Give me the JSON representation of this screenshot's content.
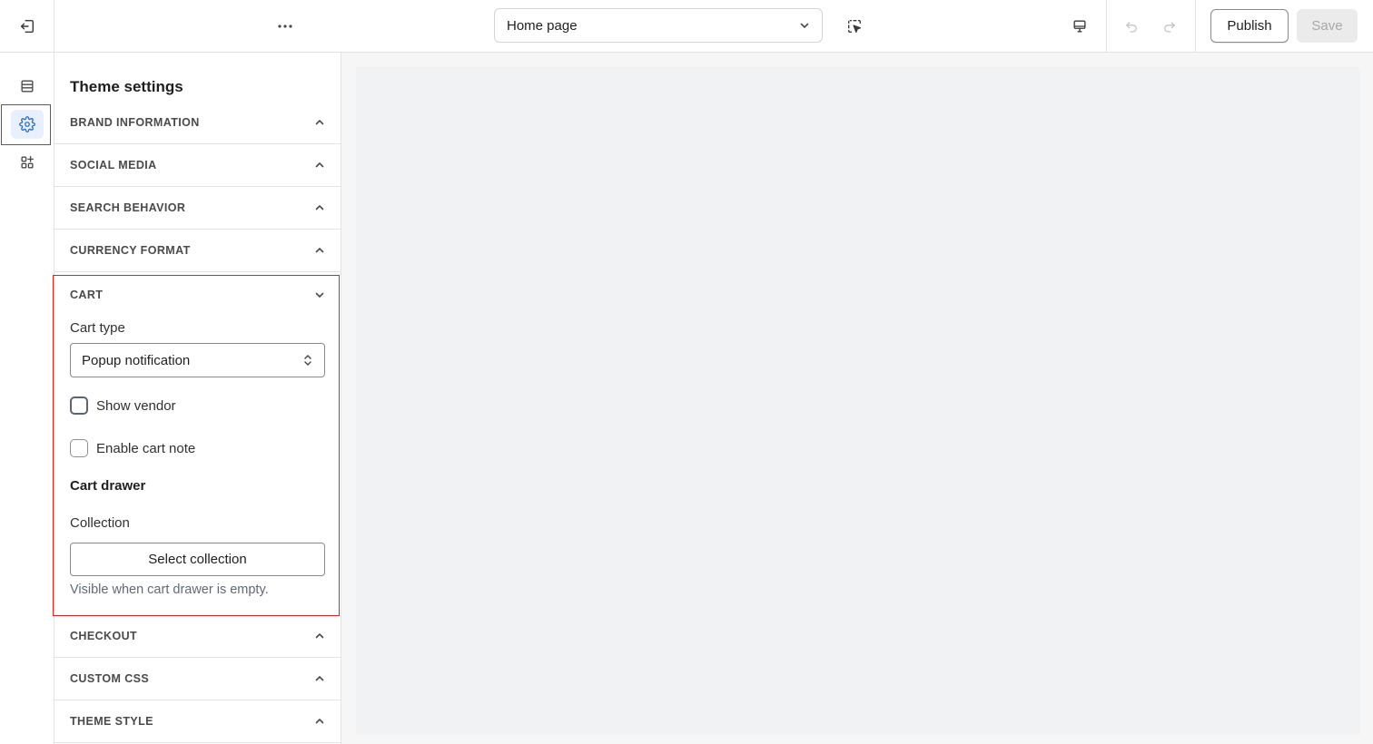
{
  "topbar": {
    "page_selector": {
      "value": "Home page"
    },
    "publish_label": "Publish",
    "save_label": "Save"
  },
  "rail": {
    "items": [
      {
        "icon": "sections-icon",
        "active": false
      },
      {
        "icon": "gear-icon",
        "active": true
      },
      {
        "icon": "apps-add-icon",
        "active": false
      }
    ]
  },
  "panel": {
    "title": "Theme settings",
    "sections_before": [
      {
        "label": "BRAND INFORMATION"
      },
      {
        "label": "SOCIAL MEDIA"
      },
      {
        "label": "SEARCH BEHAVIOR"
      },
      {
        "label": "CURRENCY FORMAT"
      }
    ],
    "cart": {
      "label": "CART",
      "cart_type_label": "Cart type",
      "cart_type_value": "Popup notification",
      "show_vendor_label": "Show vendor",
      "enable_cart_note_label": "Enable cart note",
      "cart_drawer_heading": "Cart drawer",
      "collection_label": "Collection",
      "select_collection_label": "Select collection",
      "collection_help": "Visible when cart drawer is empty."
    },
    "sections_after": [
      {
        "label": "CHECKOUT"
      },
      {
        "label": "CUSTOM CSS"
      },
      {
        "label": "THEME STYLE"
      }
    ]
  },
  "colors": {
    "accent": "#2c6ecb",
    "highlight": "#e02424",
    "preview_bg": "#f1f2f4"
  }
}
